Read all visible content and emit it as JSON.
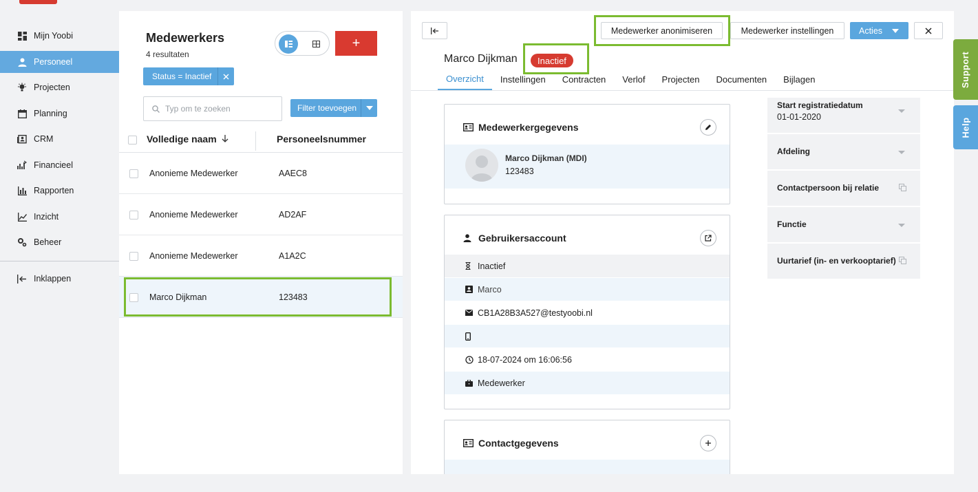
{
  "nav": {
    "items": [
      {
        "label": "Mijn Yoobi",
        "icon": "dashboard-icon"
      },
      {
        "label": "Personeel",
        "icon": "person-icon"
      },
      {
        "label": "Projecten",
        "icon": "lightbulb-icon"
      },
      {
        "label": "Planning",
        "icon": "calendar-icon"
      },
      {
        "label": "CRM",
        "icon": "contacts-icon"
      },
      {
        "label": "Financieel",
        "icon": "finance-icon"
      },
      {
        "label": "Rapporten",
        "icon": "bar-chart-icon"
      },
      {
        "label": "Inzicht",
        "icon": "line-chart-icon"
      },
      {
        "label": "Beheer",
        "icon": "settings-icon"
      }
    ],
    "collapse_label": "Inklappen"
  },
  "list": {
    "title": "Medewerkers",
    "count": "4 resultaten",
    "add_label": "+",
    "filter_chip": "Status = Inactief",
    "search_placeholder": "Typ om te zoeken",
    "filter_add_label": "Filter toevoegen",
    "columns": {
      "name": "Volledige naam",
      "number": "Personeelsnummer"
    },
    "rows": [
      {
        "name": "Anonieme Medewerker",
        "number": "AAEC8"
      },
      {
        "name": "Anonieme Medewerker",
        "number": "AD2AF"
      },
      {
        "name": "Anonieme Medewerker",
        "number": "A1A2C"
      },
      {
        "name": "Marco Dijkman",
        "number": "123483"
      }
    ]
  },
  "detail": {
    "toolbar": {
      "anonymize": "Medewerker anonimiseren",
      "settings": "Medewerker instellingen",
      "actions": "Acties"
    },
    "employee_name": "Marco Dijkman",
    "status": "Inactief",
    "tabs": [
      "Overzicht",
      "Instellingen",
      "Contracten",
      "Verlof",
      "Projecten",
      "Documenten",
      "Bijlagen"
    ],
    "employee_card": {
      "title": "Medewerkergegevens",
      "name": "Marco Dijkman (MDI)",
      "number": "123483"
    },
    "account_card": {
      "title": "Gebruikersaccount",
      "status": "Inactief",
      "username": "Marco",
      "email": "CB1A28B3A527@testyoobi.nl",
      "phone": "",
      "last_login": "18-07-2024 om 16:06:56",
      "role": "Medewerker"
    },
    "contact_card": {
      "title": "Contactgegevens"
    },
    "side": {
      "start_label": "Start registratiedatum",
      "start_value": "01-01-2020",
      "department_label": "Afdeling",
      "contact_label": "Contactpersoon bij relatie",
      "function_label": "Functie",
      "rate_label": "Uurtarief (in- en verkooptarief)"
    }
  },
  "floaters": {
    "support": "Support",
    "help": "Help"
  },
  "colors": {
    "primary": "#5aa6de",
    "danger": "#d63b30",
    "highlight": "#7bbb30",
    "nav_active": "#63a9df"
  }
}
